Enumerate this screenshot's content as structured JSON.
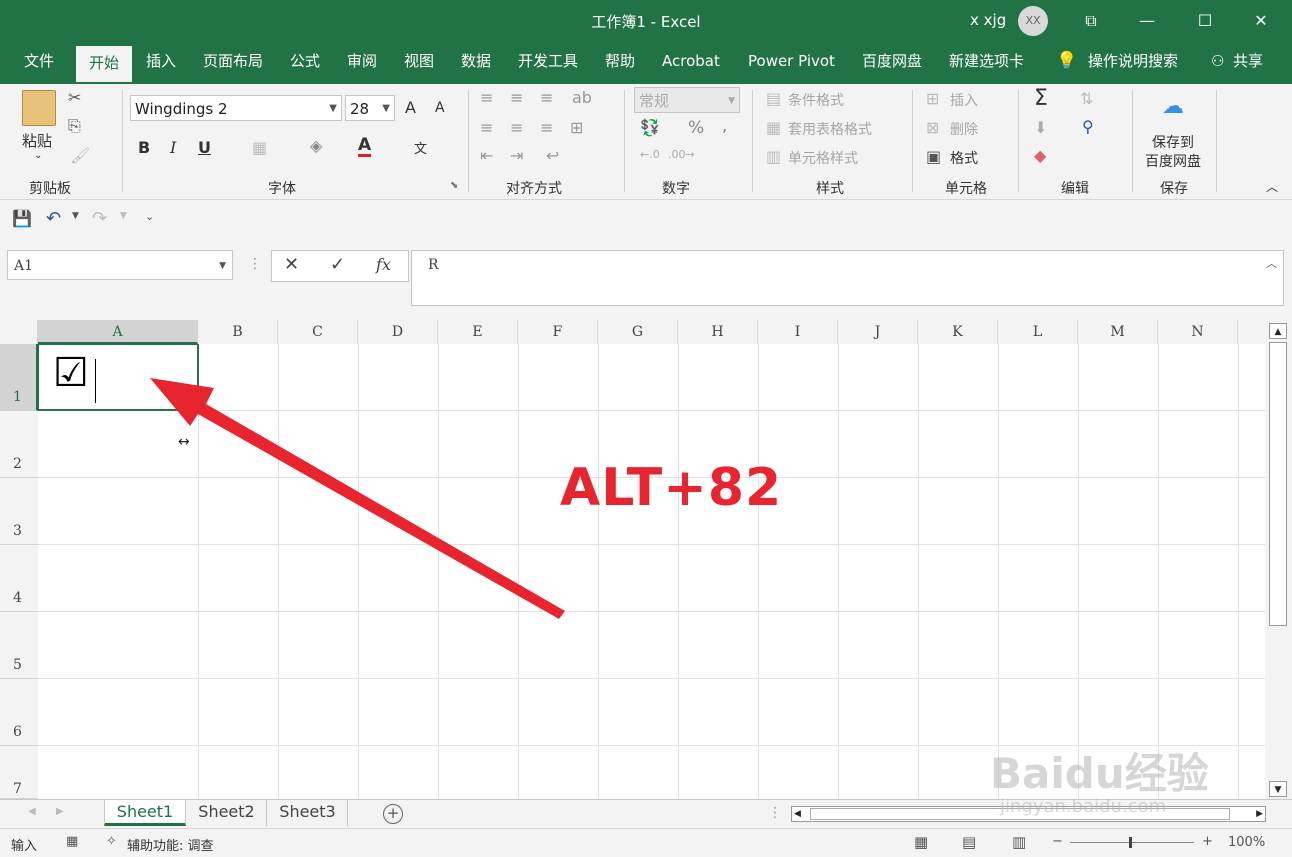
{
  "window": {
    "title": "工作簿1 - Excel",
    "user_name": "x xjg",
    "avatar_initials": "XX",
    "minimize": "—",
    "maximize": "☐",
    "close": "✕",
    "ribbon_display": "⧉"
  },
  "menu": {
    "items": [
      "文件",
      "开始",
      "插入",
      "页面布局",
      "公式",
      "审阅",
      "视图",
      "数据",
      "开发工具",
      "帮助",
      "Acrobat",
      "Power Pivot",
      "百度网盘",
      "新建选项卡"
    ],
    "active": "开始",
    "tell_me": "操作说明搜索",
    "share": "共享"
  },
  "ribbon": {
    "clipboard": {
      "paste": "粘贴",
      "label": "剪贴板"
    },
    "font": {
      "name": "Wingdings 2",
      "size": "28",
      "label": "字体",
      "bold": "B",
      "italic": "I",
      "underline": "U",
      "grow": "A",
      "shrink": "A",
      "font_color": "A",
      "phonetic": "文"
    },
    "alignment": {
      "label": "对齐方式"
    },
    "number": {
      "format": "常规",
      "label": "数字",
      "percent": "%",
      "comma": ","
    },
    "styles": {
      "conditional": "条件格式",
      "table": "套用表格格式",
      "cell": "单元格样式",
      "label": "样式"
    },
    "cells": {
      "insert": "插入",
      "delete": "删除",
      "format": "格式",
      "label": "单元格"
    },
    "editing": {
      "label": "编辑",
      "sum": "Σ"
    },
    "save": {
      "line1": "保存到",
      "line2": "百度网盘",
      "label": "保存"
    }
  },
  "formula_bar": {
    "name_box": "A1",
    "cancel": "✕",
    "enter": "✓",
    "fx": "fx",
    "content": "R"
  },
  "grid": {
    "columns": [
      "A",
      "B",
      "C",
      "D",
      "E",
      "F",
      "G",
      "H",
      "I",
      "J",
      "K",
      "L",
      "M",
      "N"
    ],
    "rows": [
      "1",
      "2",
      "3",
      "4",
      "5",
      "6",
      "7"
    ],
    "cell_a1": "☑"
  },
  "annotation": {
    "text": "ALT+82",
    "color": "#e8252f"
  },
  "sheets": {
    "tabs": [
      "Sheet1",
      "Sheet2",
      "Sheet3"
    ],
    "active": "Sheet1",
    "add": "+"
  },
  "status": {
    "mode": "输入",
    "accessibility": "辅助功能: 调查",
    "zoom": "100%"
  },
  "watermark": {
    "line1": "Baidu经验",
    "line2": "jingyan.baidu.com"
  },
  "colors": {
    "excel_green": "#217346",
    "annotation_red": "#e8252f"
  }
}
